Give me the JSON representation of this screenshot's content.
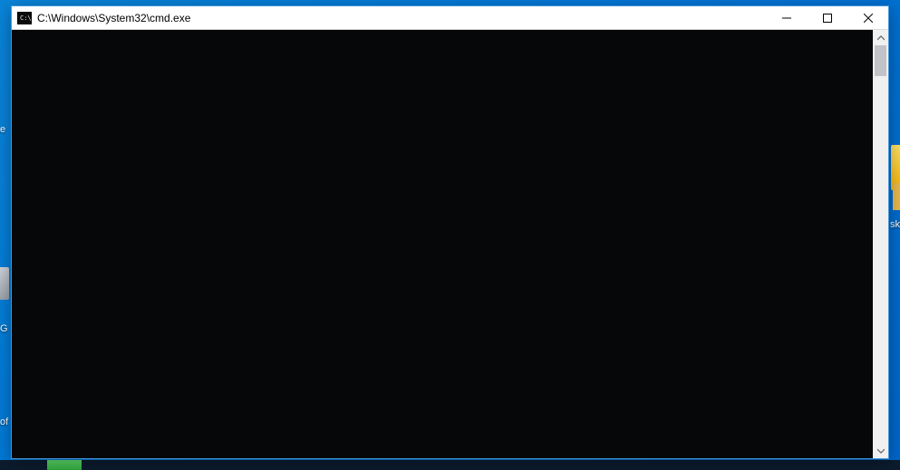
{
  "window": {
    "title": "C:\\Windows\\System32\\cmd.exe",
    "controls": {
      "minimize": "Minimize",
      "maximize": "Maximize",
      "close": "Close"
    }
  },
  "console": {
    "content": ""
  },
  "desktop": {
    "fragments": {
      "f1": "e",
      "f2": "sk",
      "f3": "G",
      "f4": "of"
    }
  }
}
